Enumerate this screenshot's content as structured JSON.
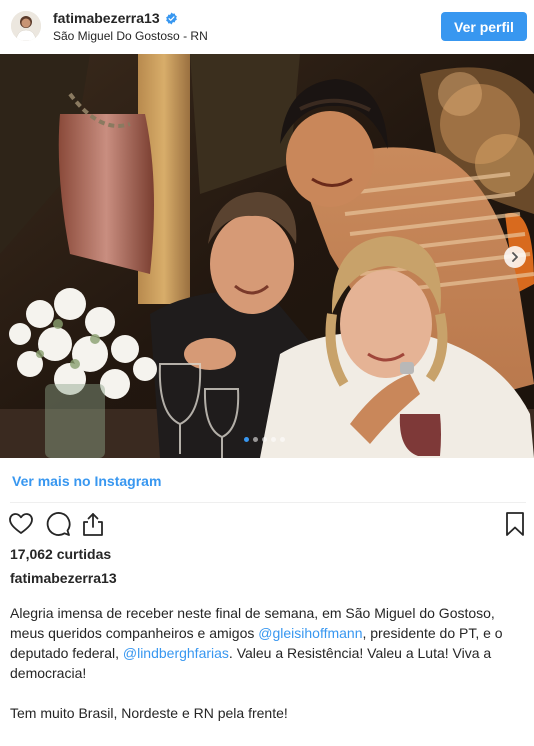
{
  "header": {
    "username": "fatimabezerra13",
    "location": "São Miguel Do Gostoso - RN",
    "profile_button": "Ver perfil",
    "verified_icon": "verified-badge-icon",
    "avatar_icon": "profile-avatar"
  },
  "carousel": {
    "total": 5,
    "active": 1,
    "next_icon": "chevron-right-icon"
  },
  "more_link": "Ver mais no Instagram",
  "actions": {
    "like_icon": "heart-icon",
    "comment_icon": "comment-icon",
    "share_icon": "share-icon",
    "save_icon": "bookmark-icon"
  },
  "likes": "17,062 curtidas",
  "owner": "fatimabezerra13",
  "caption": {
    "p1_a": "Alegria imensa de receber neste final de semana, em São Miguel do Gostoso, meus queridos companheiros e amigos ",
    "mention1": "@gleisihoffmann",
    "p1_b": ", presidente do PT, e o deputado federal, ",
    "mention2": "@lindberghfarias",
    "p1_c": ". Valeu a Resistência! Valeu a Luta! Viva a democracia!",
    "p2": "Tem muito Brasil, Nordeste e RN pela frente!",
    "p3": "-"
  },
  "colors": {
    "accent": "#3897f0",
    "text": "#262626",
    "divider": "#efefef"
  }
}
